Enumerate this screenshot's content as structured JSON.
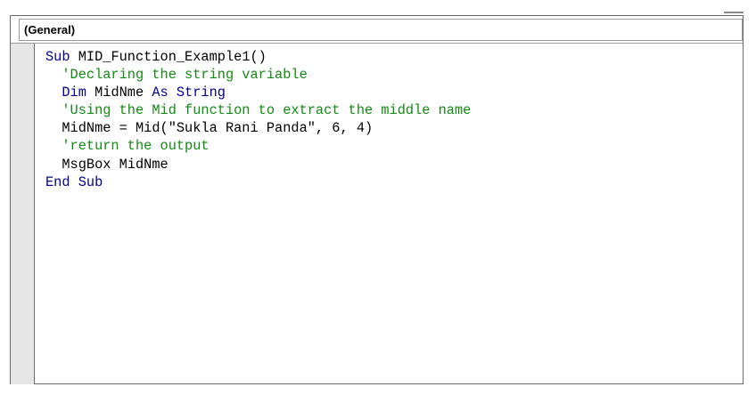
{
  "dropdown": {
    "label": "(General)"
  },
  "code": {
    "lines": [
      {
        "indent": "",
        "parts": [
          {
            "type": "kw",
            "text": "Sub"
          },
          {
            "type": "tx",
            "text": " MID_Function_Example1()"
          }
        ]
      },
      {
        "indent": "  ",
        "parts": [
          {
            "type": "cm",
            "text": "'Declaring the string variable"
          }
        ]
      },
      {
        "indent": "  ",
        "parts": [
          {
            "type": "kw",
            "text": "Dim"
          },
          {
            "type": "tx",
            "text": " MidNme "
          },
          {
            "type": "kw",
            "text": "As"
          },
          {
            "type": "tx",
            "text": " "
          },
          {
            "type": "kw",
            "text": "String"
          }
        ]
      },
      {
        "indent": "  ",
        "parts": [
          {
            "type": "cm",
            "text": "'Using the Mid function to extract the middle name"
          }
        ]
      },
      {
        "indent": "  ",
        "parts": [
          {
            "type": "tx",
            "text": "MidNme = Mid(\"Sukla Rani Panda\", 6, 4)"
          }
        ]
      },
      {
        "indent": "  ",
        "parts": [
          {
            "type": "cm",
            "text": "'return the output"
          }
        ]
      },
      {
        "indent": "  ",
        "parts": [
          {
            "type": "tx",
            "text": "MsgBox MidNme"
          }
        ]
      },
      {
        "indent": "",
        "parts": [
          {
            "type": "kw",
            "text": "End Sub"
          }
        ]
      }
    ]
  },
  "colors": {
    "keyword": "#00008b",
    "comment": "#138a13",
    "text": "#000000",
    "margin": "#e6e6e6"
  }
}
